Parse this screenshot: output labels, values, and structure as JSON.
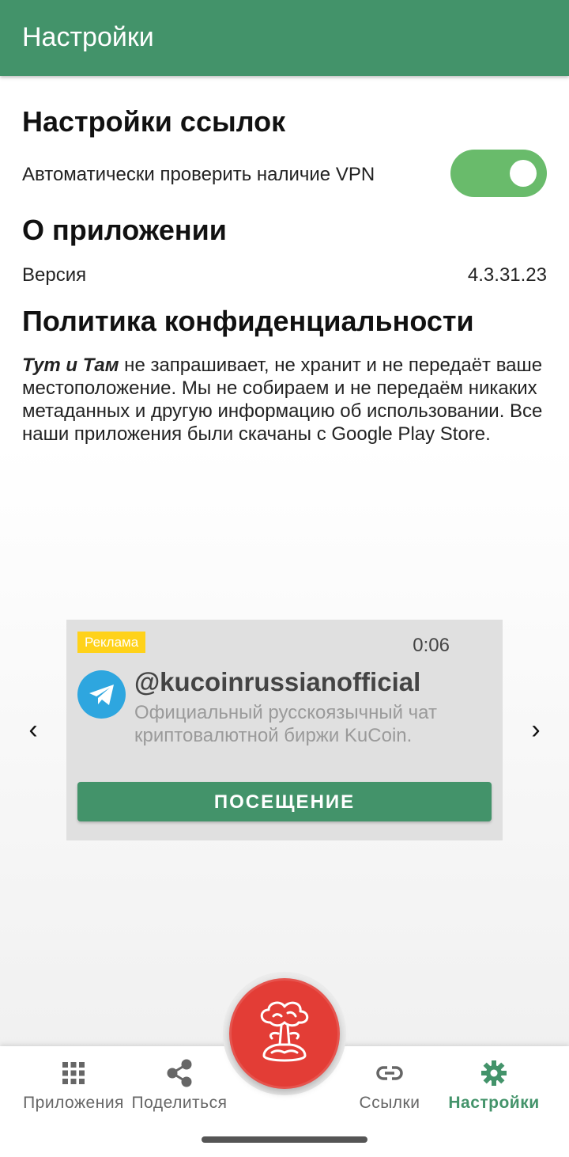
{
  "app_bar": {
    "title": "Настройки"
  },
  "link_settings": {
    "title": "Настройки ссылок",
    "vpn_check_label": "Автоматически проверить наличие VPN",
    "vpn_check_enabled": true
  },
  "about": {
    "title": "О приложении",
    "version_label": "Версия",
    "version_value": "4.3.31.23"
  },
  "privacy": {
    "title": "Политика конфиденциальности",
    "app_name": "Тут и Там",
    "text": " не запрашивает, не хранит и не передаёт ваше местоположение. Мы не собираем и не передаём никаких метаданных и другую информацию об использовании. Все наши приложения были скачаны с Google Play Store."
  },
  "ad": {
    "badge": "Реклама",
    "timer": "0:06",
    "handle": "@kucoinrussianofficial",
    "description": "Официальный русскоязычный чат криптовалютной биржи KuCoin.",
    "button": "ПОСЕЩЕНИЕ",
    "prev_arrow": "‹",
    "next_arrow": "›"
  },
  "bottom_nav": {
    "items": [
      {
        "label": "Приложения",
        "icon": "grid-icon",
        "active": false
      },
      {
        "label": "Поделиться",
        "icon": "share-icon",
        "active": false
      },
      {
        "label": "Ссылки",
        "icon": "link-icon",
        "active": false
      },
      {
        "label": "Настройки",
        "icon": "gear-icon",
        "active": true
      }
    ],
    "fab_icon": "mushroom-cloud-icon"
  },
  "colors": {
    "primary": "#43936a",
    "toggle_on": "#69bb6b",
    "fab": "#e33d36",
    "ad_badge": "#ffd21a",
    "telegram": "#2ea6df"
  }
}
